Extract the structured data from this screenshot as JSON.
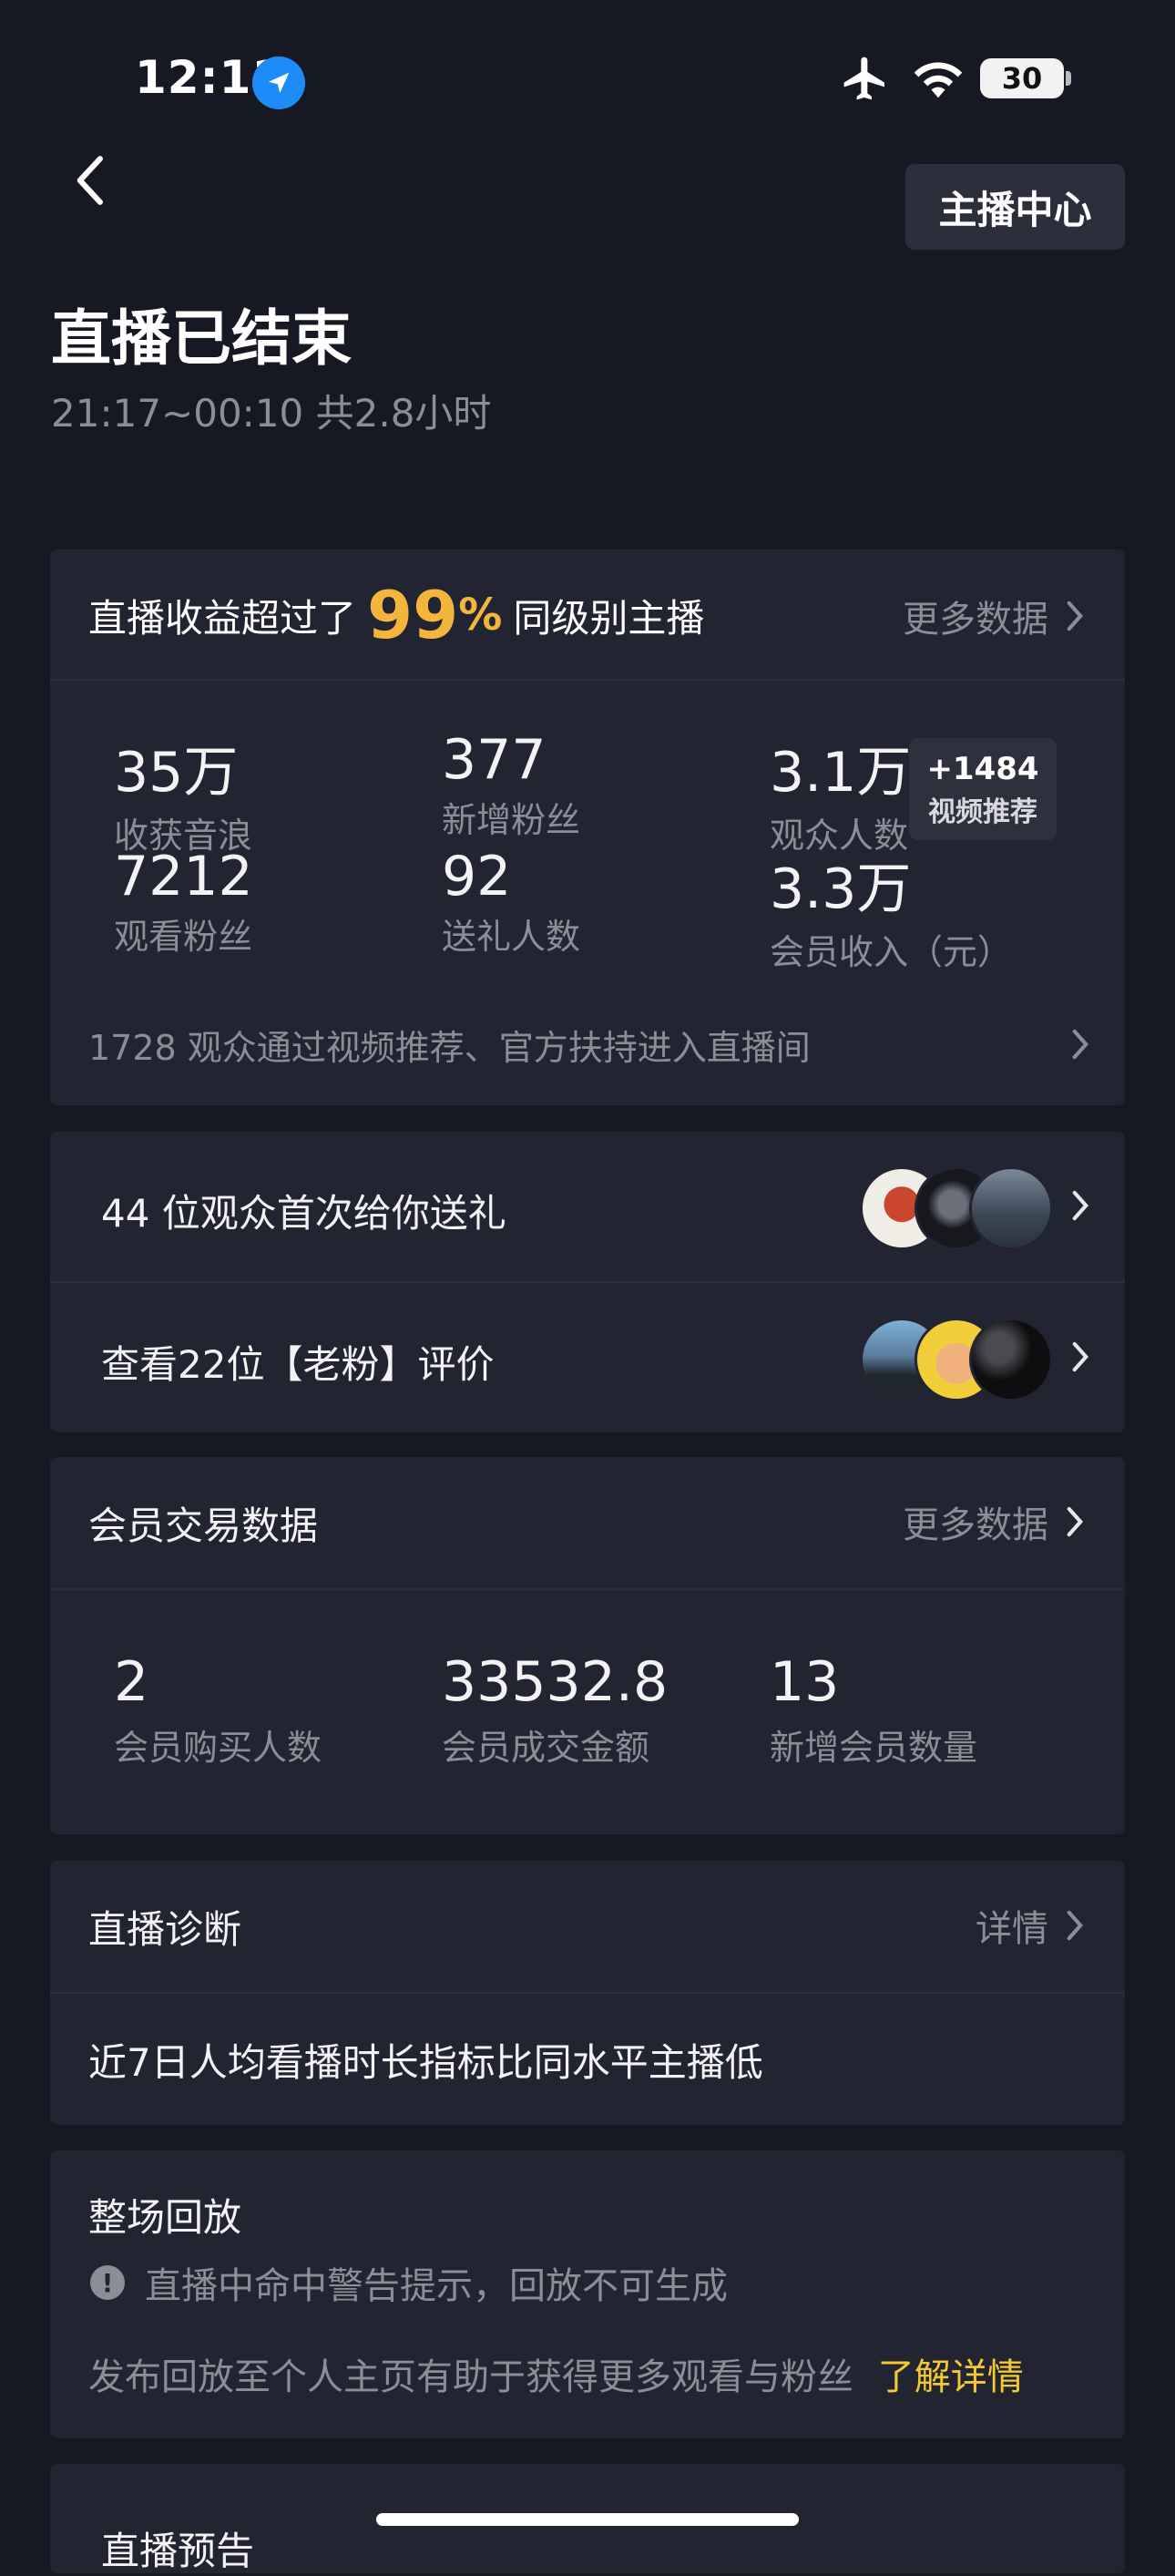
{
  "status_bar": {
    "time": "12:11",
    "battery": "30",
    "icons": [
      "location-arrow-icon",
      "airplane-icon",
      "wifi-icon",
      "battery-icon"
    ]
  },
  "nav": {
    "back_icon": "chevron-left-icon",
    "anchor_center": "主播中心"
  },
  "header": {
    "title": "直播已结束",
    "subtitle": "21:17~00:10 共2.8小时"
  },
  "summary": {
    "prefix": "直播收益超过了",
    "percent_value": "99",
    "percent_sign": "%",
    "suffix": "同级别主播",
    "more": "更多数据",
    "stats": [
      {
        "value": "35万",
        "label": "收获音浪"
      },
      {
        "value": "377",
        "label": "新增粉丝"
      },
      {
        "value": "3.1万",
        "label": "观众人数"
      },
      {
        "value": "7212",
        "label": "观看粉丝"
      },
      {
        "value": "92",
        "label": "送礼人数"
      },
      {
        "value": "3.3万",
        "label": "会员收入（元）"
      }
    ],
    "badge_value": "+1484",
    "badge_label": "视频推荐",
    "footer": "1728 观众通过视频推荐、官方扶持进入直播间"
  },
  "gifts_row": {
    "label": "44 位观众首次给你送礼"
  },
  "fans_row": {
    "label": "查看22位【老粉】评价"
  },
  "membership": {
    "title": "会员交易数据",
    "more": "更多数据",
    "stats": [
      {
        "value": "2",
        "label": "会员购买人数"
      },
      {
        "value": "33532.8",
        "label": "会员成交金额"
      },
      {
        "value": "13",
        "label": "新增会员数量"
      }
    ]
  },
  "diagnosis": {
    "title": "直播诊断",
    "detail": "详情",
    "text": "近7日人均看播时长指标比同水平主播低"
  },
  "replay": {
    "title": "整场回放",
    "warning": "直播中命中警告提示，回放不可生成",
    "tip": "发布回放至个人主页有助于获得更多观看与粉丝",
    "link": "了解详情"
  },
  "preview": {
    "title": "直播预告"
  },
  "colors": {
    "background": "#161824",
    "card": "#222531",
    "accent_yellow": "#f3c833",
    "accent_orange": "#f3b53c",
    "muted": "#8b8e99"
  }
}
